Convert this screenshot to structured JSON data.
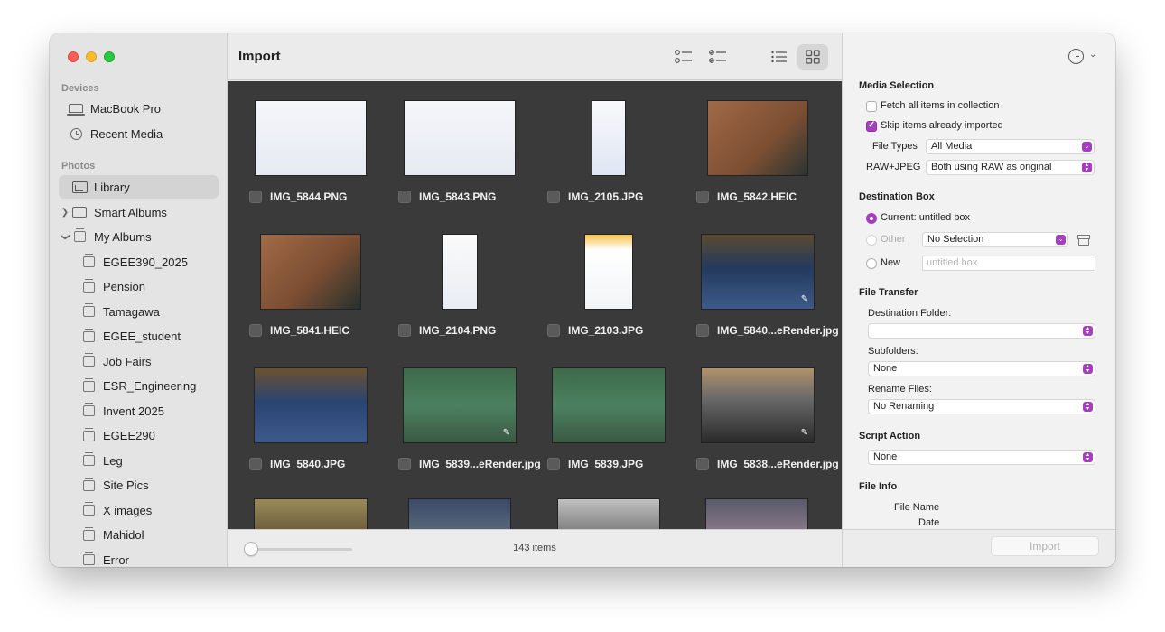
{
  "sidebar": {
    "devices_label": "Devices",
    "devices": [
      {
        "label": "MacBook Pro",
        "icon": "laptop-icon"
      },
      {
        "label": "Recent Media",
        "icon": "clock-icon"
      }
    ],
    "photos_label": "Photos",
    "library_label": "Library",
    "smart_albums_label": "Smart Albums",
    "my_albums_label": "My Albums",
    "albums": [
      "EGEE390_2025",
      "Pension",
      "Tamagawa",
      "EGEE_student",
      "Job Fairs",
      "ESR_Engineering",
      "Invent 2025",
      "EGEE290",
      "Leg",
      "Site Pics",
      "X images",
      "Mahidol",
      "Error"
    ]
  },
  "main": {
    "title": "Import",
    "items_count": "143 items",
    "thumbnails": [
      {
        "name": "IMG_5844.PNG"
      },
      {
        "name": "IMG_5843.PNG"
      },
      {
        "name": "IMG_2105.JPG"
      },
      {
        "name": "IMG_5842.HEIC"
      },
      {
        "name": "IMG_5841.HEIC"
      },
      {
        "name": "IMG_2104.PNG"
      },
      {
        "name": "IMG_2103.JPG"
      },
      {
        "name": "IMG_5840...eRender.jpg"
      },
      {
        "name": "IMG_5840.JPG"
      },
      {
        "name": "IMG_5839...eRender.jpg"
      },
      {
        "name": "IMG_5839.JPG"
      },
      {
        "name": "IMG_5838...eRender.jpg"
      }
    ]
  },
  "panel": {
    "media_selection": "Media Selection",
    "fetch_all": "Fetch all items in collection",
    "skip_imported": "Skip items already imported",
    "file_types_label": "File Types",
    "file_types_value": "All Media",
    "raw_jpeg_label": "RAW+JPEG",
    "raw_jpeg_value": "Both using RAW as original",
    "destination_box": "Destination Box",
    "current_label": "Current: untitled box",
    "other_label": "Other",
    "other_value": "No Selection",
    "new_label": "New",
    "new_placeholder": "untitled box",
    "file_transfer": "File Transfer",
    "destination_folder_label": "Destination Folder:",
    "destination_folder_value": "",
    "subfolders_label": "Subfolders:",
    "subfolders_value": "None",
    "rename_label": "Rename Files:",
    "rename_value": "No Renaming",
    "script_action": "Script Action",
    "script_value": "None",
    "file_info": "File Info",
    "file_name_label": "File Name",
    "date_label": "Date",
    "import_button": "Import"
  },
  "colors": {
    "accent": "#a53fbf",
    "grid_bg": "#3a3a3a"
  }
}
